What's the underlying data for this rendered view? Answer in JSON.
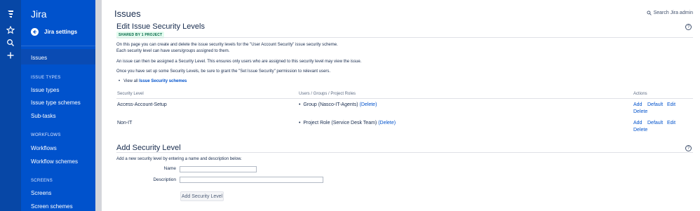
{
  "sidebar": {
    "title": "Jira",
    "back_label": "Jira settings",
    "active_item": "Issues",
    "groups": [
      {
        "heading": "ISSUE TYPES",
        "items": [
          "Issue types",
          "Issue type schemes",
          "Sub-tasks"
        ]
      },
      {
        "heading": "WORKFLOWS",
        "items": [
          "Workflows",
          "Workflow schemes"
        ]
      },
      {
        "heading": "SCREENS",
        "items": [
          "Screens",
          "Screen schemes"
        ]
      }
    ]
  },
  "header": {
    "title": "Issues",
    "search_label": "Search Jira admin"
  },
  "edit_section": {
    "title": "Edit Issue Security Levels",
    "badge": "SHARED BY 1 PROJECT",
    "paragraph1_line1": "On this page you can create and delete the issue security levels for the \"User Account Security\" issue security scheme.",
    "paragraph1_line2": "Each security level can have users/groups assigned to them.",
    "paragraph2": "An issue can then be assigned a Security Level. This ensures only users who are assigned to this security level may view the issue.",
    "paragraph3": "Once you have set up some Security Levels, be sure to grant the \"Set Issue Security\" permission to relevant users.",
    "view_all_prefix": "View all",
    "view_all_link": "Issue Security schemes"
  },
  "table": {
    "headers": {
      "level": "Security Level",
      "users": "Users / Groups / Project Roles",
      "actions": "Actions"
    },
    "rows": [
      {
        "level": "Access-Account-Setup",
        "member": "Group (Nasco-IT-Agents)",
        "delete_member": "(Delete)"
      },
      {
        "level": "Non-IT",
        "member": "Project Role (Service Desk Team)",
        "delete_member": "(Delete)"
      }
    ],
    "action_labels": {
      "add": "Add",
      "default": "Default",
      "edit": "Edit",
      "delete": "Delete"
    }
  },
  "add_section": {
    "title": "Add Security Level",
    "intro": "Add a new security level by entering a name and description below.",
    "name_label": "Name",
    "description_label": "Description",
    "name_value": "",
    "description_value": "",
    "submit_label": "Add Security Level"
  },
  "colors": {
    "rail": "#0747a6",
    "sidebar": "#0052cc",
    "link": "#0052cc",
    "badge_bg": "#e3fcef",
    "badge_text": "#006644"
  }
}
